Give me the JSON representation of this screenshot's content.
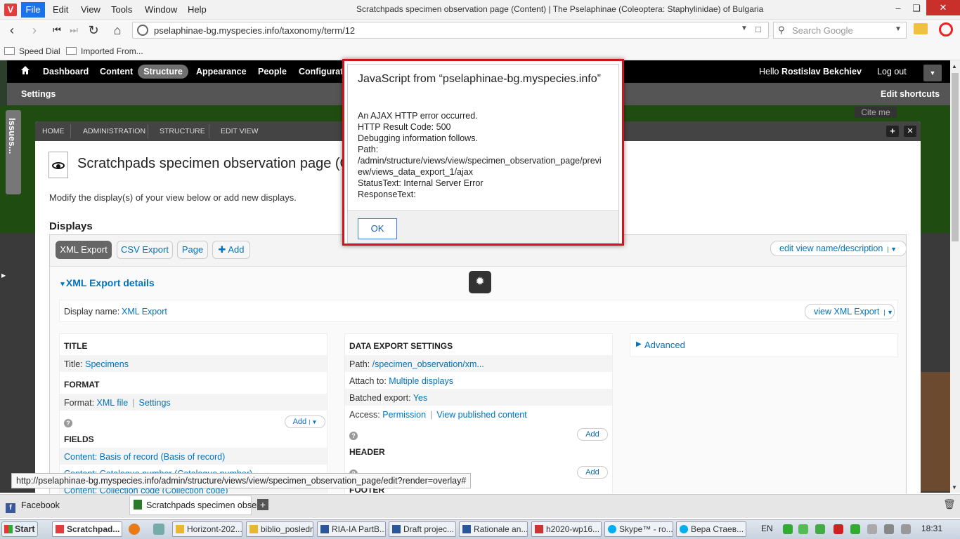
{
  "browser": {
    "logo": "V",
    "menu": [
      "File",
      "Edit",
      "View",
      "Tools",
      "Window",
      "Help"
    ],
    "window_title": "Scratchpads specimen observation page (Content) | The Pselaphinae (Coleoptera: Staphylinidae) of Bulgaria",
    "url": "pselaphinae-bg.myspecies.info/taxonomy/term/12",
    "search_placeholder": "Search Google",
    "bookmarks": [
      "Speed Dial",
      "Imported From..."
    ],
    "status_url": "http://pselaphinae-bg.myspecies.info/admin/structure/views/view/specimen_observation_page/edit?render=overlay#",
    "tabs": [
      {
        "label": "Facebook",
        "icon": "facebook-icon"
      },
      {
        "label": "Scratchpads specimen obser",
        "icon": "scratchpads-icon"
      }
    ]
  },
  "admin_toolbar": {
    "items": [
      "Dashboard",
      "Content",
      "Structure",
      "Appearance",
      "People",
      "Configurati"
    ],
    "active": "Structure",
    "hello_prefix": "Hello",
    "user": "Rostislav Bekchiev",
    "logout": "Log out",
    "shortcuts_left": "Settings",
    "shortcuts_right": "Edit shortcuts"
  },
  "site": {
    "cite_me": "Cite me",
    "issues_tab": "Issues..."
  },
  "overlay": {
    "breadcrumbs": [
      "HOME",
      "ADMINISTRATION",
      "STRUCTURE",
      "EDIT VIEW"
    ],
    "title": "Scratchpads specimen observation page (Conte",
    "description": "Modify the display(s) of your view below or add new displays.",
    "displays_heading": "Displays",
    "display_tabs": [
      "XML Export",
      "CSV Export",
      "Page",
      "Add"
    ],
    "active_tab": "XML Export",
    "edit_view_label": "edit view name/description",
    "details_heading": "XML Export details",
    "display_name_label": "Display name:",
    "display_name_value": "XML Export",
    "view_button": "view XML Export",
    "col1": {
      "title_h": "TITLE",
      "title_label": "Title:",
      "title_value": "Specimens",
      "format_h": "FORMAT",
      "format_label": "Format:",
      "format_value": "XML file",
      "format_settings": "Settings",
      "add": "Add",
      "fields_h": "FIELDS",
      "field1": "Content: Basis of record (Basis of record)",
      "field2": "Content: Catalogue number (Catalogue number)",
      "field3": "Content: Collection code (Collection code)"
    },
    "col2": {
      "settings_h": "DATA EXPORT SETTINGS",
      "path_label": "Path:",
      "path_value": "/specimen_observation/xm...",
      "attach_label": "Attach to:",
      "attach_value": "Multiple displays",
      "batched_label": "Batched export:",
      "batched_value": "Yes",
      "access_label": "Access:",
      "access_value1": "Permission",
      "access_value2": "View published content",
      "add": "Add",
      "header_h": "HEADER",
      "footer_h": "FOOTER"
    },
    "advanced": "Advanced"
  },
  "dialog": {
    "title": "JavaScript from “pselaphinae-bg.myspecies.info”",
    "lines": [
      "An AJAX HTTP error occurred.",
      "HTTP Result Code: 500",
      "Debugging information follows.",
      "Path:",
      "/admin/structure/views/view/specimen_observation_page/previ",
      "ew/views_data_export_1/ajax",
      "StatusText: Internal Server Error",
      "ResponseText:"
    ],
    "ok": "OK"
  },
  "taskbar": {
    "start": "Start",
    "tasks": [
      "Scratchpad...",
      "Horizont-202...",
      "biblio_posledna",
      "RIA-IA PartB...",
      "Draft projec...",
      "Rationale an...",
      "h2020-wp16...",
      "Skype™ - ro...",
      "Вера Стаев..."
    ],
    "language": "EN",
    "time": "18:31"
  },
  "colors": {
    "dialog_border": "#d0131c",
    "link": "#0074bd",
    "file_menu": "#1a73e8"
  }
}
